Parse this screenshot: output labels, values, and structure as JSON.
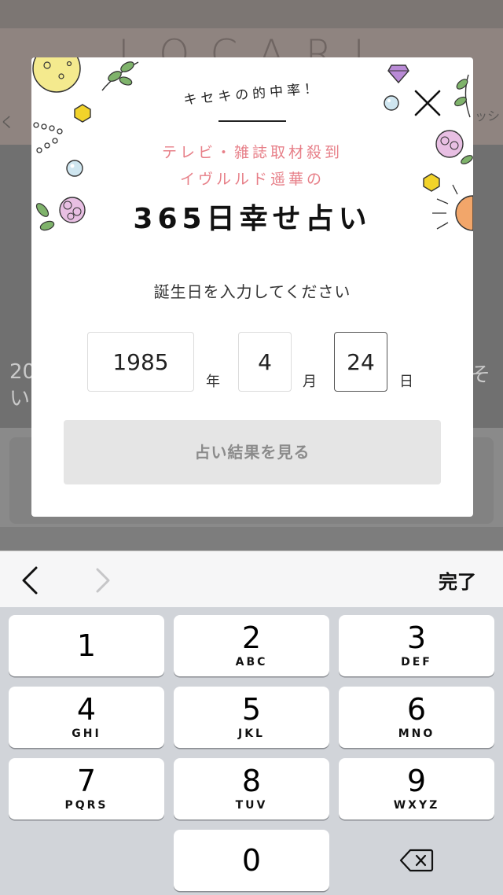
{
  "background": {
    "logo": "LOCARI",
    "side_left": "く",
    "side_right": "ッシ",
    "hero_line1": "20",
    "hero_line2": "い",
    "hero_right": "そ"
  },
  "modal": {
    "tagline": "キセキの的中率！",
    "subtitle_line1": "テレビ・雑誌取材殺到",
    "subtitle_line2": "イヴルルド遥華の",
    "headline": "365日幸せ占い",
    "prompt": "誕生日を入力してください",
    "year_value": "1985",
    "year_unit": "年",
    "month_value": "4",
    "month_unit": "月",
    "day_value": "24",
    "day_unit": "日",
    "submit_label": "占い結果を見る",
    "accent_pink": "#e77f88",
    "close_icon": "close-icon"
  },
  "keyboard": {
    "done_label": "完了",
    "prev_icon": "chevron-left-icon",
    "next_icon": "chevron-right-icon",
    "keys": [
      {
        "digit": "1",
        "letters": ""
      },
      {
        "digit": "2",
        "letters": "ABC"
      },
      {
        "digit": "3",
        "letters": "DEF"
      },
      {
        "digit": "4",
        "letters": "GHI"
      },
      {
        "digit": "5",
        "letters": "JKL"
      },
      {
        "digit": "6",
        "letters": "MNO"
      },
      {
        "digit": "7",
        "letters": "PQRS"
      },
      {
        "digit": "8",
        "letters": "TUV"
      },
      {
        "digit": "9",
        "letters": "WXYZ"
      },
      {
        "digit": "0",
        "letters": ""
      }
    ],
    "delete_icon": "backspace-icon"
  }
}
